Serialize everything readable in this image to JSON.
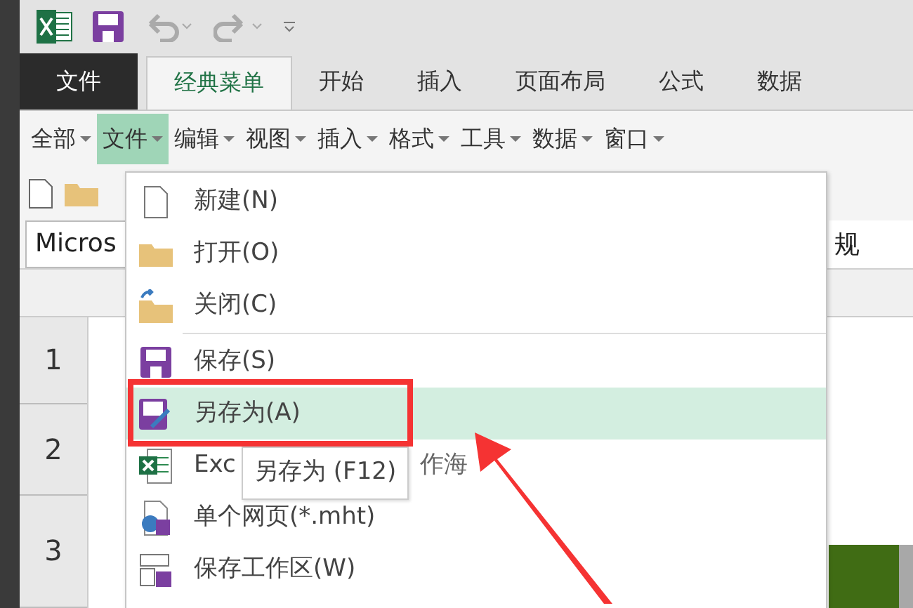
{
  "tabs": [
    {
      "label": "文件",
      "kind": "backstage",
      "selected": false
    },
    {
      "label": "经典菜单",
      "kind": "tab",
      "selected": true
    },
    {
      "label": "开始",
      "kind": "tab",
      "selected": false
    },
    {
      "label": "插入",
      "kind": "tab",
      "selected": false
    },
    {
      "label": "页面布局",
      "kind": "tab",
      "selected": false
    },
    {
      "label": "公式",
      "kind": "tab",
      "selected": false
    },
    {
      "label": "数据",
      "kind": "tab",
      "selected": false
    }
  ],
  "menubar": [
    {
      "label": "全部",
      "selected": false
    },
    {
      "label": "文件",
      "selected": true
    },
    {
      "label": "编辑",
      "selected": false
    },
    {
      "label": "视图",
      "selected": false
    },
    {
      "label": "插入",
      "selected": false
    },
    {
      "label": "格式",
      "selected": false
    },
    {
      "label": "工具",
      "selected": false
    },
    {
      "label": "数据",
      "selected": false
    },
    {
      "label": "窗口",
      "selected": false
    }
  ],
  "font_box": {
    "value": "Micros"
  },
  "format_box": {
    "value": "规"
  },
  "row_headers": [
    "1",
    "2",
    "3"
  ],
  "file_menu": [
    {
      "label": "新建(N)",
      "selected": false
    },
    {
      "label": "打开(O)",
      "selected": false
    },
    {
      "label": "关闭(C)",
      "selected": false,
      "separator_after": true
    },
    {
      "label": "保存(S)",
      "selected": false
    },
    {
      "label": "另存为(A)",
      "selected": true
    },
    {
      "label": "Exc",
      "label_tail": "作海",
      "selected": false
    },
    {
      "label": "单个网页(*.mht)",
      "selected": false
    },
    {
      "label": "保存工作区(W)",
      "selected": false
    }
  ],
  "tooltip": "另存为 (F12)"
}
